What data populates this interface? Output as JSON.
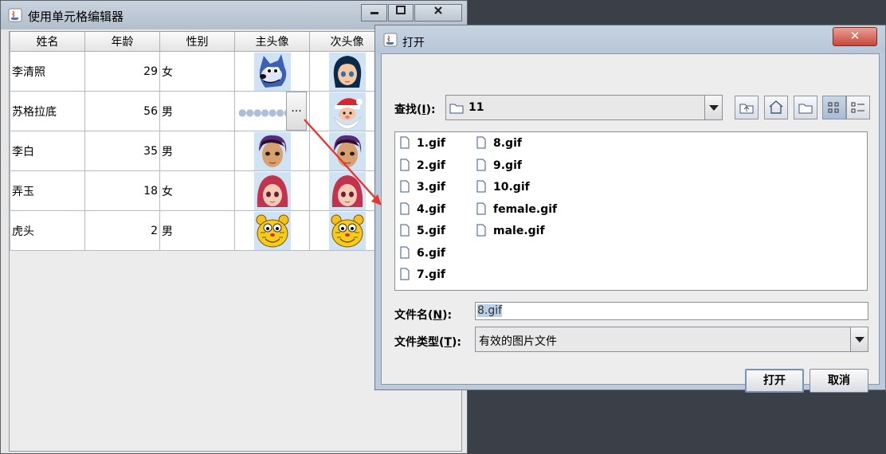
{
  "main_window": {
    "title": "使用单元格编辑器",
    "columns": [
      "姓名",
      "年龄",
      "性别",
      "主头像",
      "次头像"
    ],
    "rows": [
      {
        "name": "李清照",
        "age": "29",
        "gender": "女",
        "avatar1": "wolf-avatar",
        "avatar2": "girl-avatar"
      },
      {
        "name": "苏格拉底",
        "age": "56",
        "gender": "男",
        "avatar1": "editing",
        "avatar2": "santa-avatar"
      },
      {
        "name": "李白",
        "age": "35",
        "gender": "男",
        "avatar1": "boy-avatar",
        "avatar2": "boy-avatar"
      },
      {
        "name": "弄玉",
        "age": "18",
        "gender": "女",
        "avatar1": "pink-girl-avatar",
        "avatar2": "pink-girl-avatar"
      },
      {
        "name": "虎头",
        "age": "2",
        "gender": "男",
        "avatar1": "tiger-avatar",
        "avatar2": "tiger-avatar"
      }
    ],
    "editor_button_label": "..."
  },
  "dialog": {
    "title": "打开",
    "close_label": "✕",
    "look_in_label": "查找(",
    "look_in_mnemonic": "I",
    "look_in_suffix": "):",
    "look_in_value": "11",
    "files_col1": [
      "1.gif",
      "2.gif",
      "3.gif",
      "4.gif",
      "5.gif",
      "6.gif",
      "7.gif"
    ],
    "files_col2": [
      "8.gif",
      "9.gif",
      "10.gif",
      "female.gif",
      "male.gif"
    ],
    "filename_label": "文件名(",
    "filename_mnemonic": "N",
    "filename_suffix": "):",
    "filename_value": "8.gif",
    "filetype_label": "文件类型(",
    "filetype_mnemonic": "T",
    "filetype_suffix": "):",
    "filetype_value": "有效的图片文件",
    "open_button": "打开",
    "cancel_button": "取消"
  },
  "colors": {
    "arrow": "#e8352a",
    "selection": "#b8cfe5"
  }
}
